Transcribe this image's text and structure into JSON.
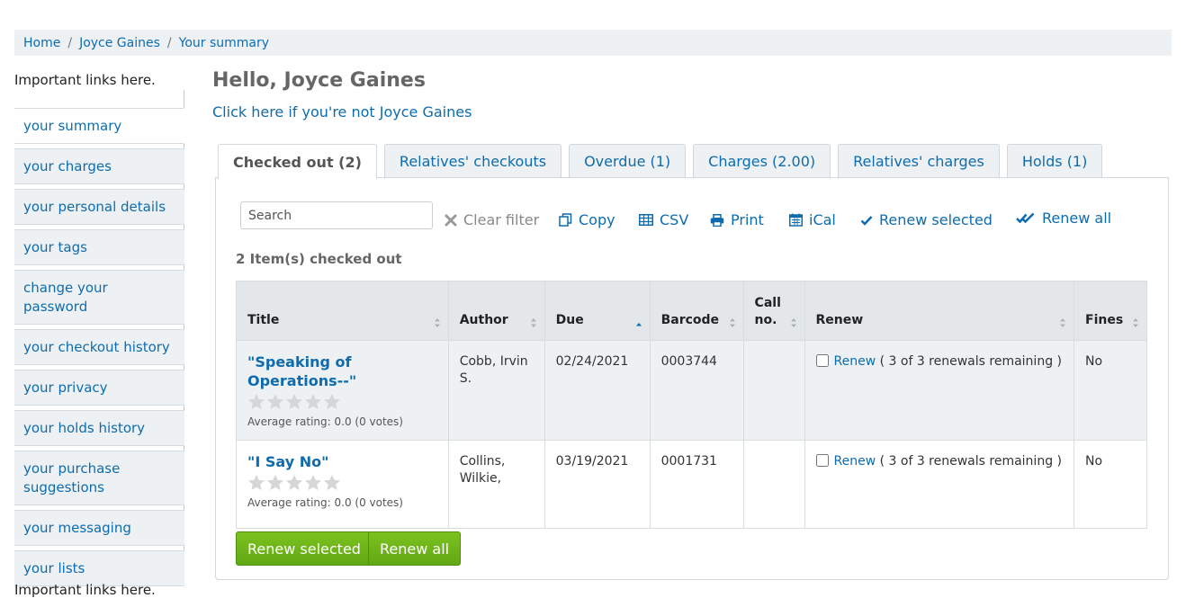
{
  "breadcrumb": {
    "home": "Home",
    "user": "Joyce Gaines",
    "current": "Your summary",
    "separator": "/"
  },
  "sidebar": {
    "important_top": "Important links here.",
    "important_bottom": "Important links here.",
    "items": [
      {
        "label": "your summary",
        "active": true
      },
      {
        "label": "your charges"
      },
      {
        "label": "your personal details"
      },
      {
        "label": "your tags"
      },
      {
        "label": "change your password"
      },
      {
        "label": "your checkout history"
      },
      {
        "label": "your privacy"
      },
      {
        "label": "your holds history"
      },
      {
        "label": "your purchase suggestions"
      },
      {
        "label": "your messaging"
      },
      {
        "label": "your lists"
      }
    ]
  },
  "main": {
    "greeting": "Hello, Joyce Gaines",
    "not_you_link": "Click here if you're not Joyce Gaines",
    "tabs": [
      {
        "label": "Checked out (2)",
        "active": true
      },
      {
        "label": "Relatives' checkouts"
      },
      {
        "label": "Overdue (1)"
      },
      {
        "label": "Charges (2.00)"
      },
      {
        "label": "Relatives' charges"
      },
      {
        "label": "Holds (1)"
      }
    ],
    "toolbar": {
      "search_placeholder": "Search",
      "clear_filter": "Clear filter",
      "copy": "Copy",
      "csv": "CSV",
      "print": "Print",
      "ical": "iCal",
      "renew_selected": "Renew selected",
      "renew_all": "Renew all"
    },
    "items_count": "2 Item(s) checked out",
    "table": {
      "headers": {
        "title": "Title",
        "author": "Author",
        "due": "Due",
        "barcode": "Barcode",
        "call_no": "Call no.",
        "renew": "Renew",
        "fines": "Fines"
      },
      "rows": [
        {
          "title": "\"Speaking of Operations--\"",
          "rating": "Average rating: 0.0 (0 votes)",
          "author": "Cobb, Irvin S.",
          "due": "02/24/2021",
          "overdue": true,
          "barcode": "0003744",
          "call_no": "",
          "renew_link": "Renew",
          "renew_note": "( 3 of 3 renewals remaining )",
          "fines": "No"
        },
        {
          "title": "\"I Say No\"",
          "rating": "Average rating: 0.0 (0 votes)",
          "author": "Collins, Wilkie,",
          "due": "03/19/2021",
          "overdue": false,
          "barcode": "0001731",
          "call_no": "",
          "renew_link": "Renew",
          "renew_note": "( 3 of 3 renewals remaining )",
          "fines": "No"
        }
      ]
    },
    "buttons": {
      "renew_selected": "Renew selected",
      "renew_all": "Renew all"
    }
  },
  "colors": {
    "link": "#0e6cae",
    "overdue": "#c62828",
    "button_green": "#6cb516",
    "panel_bg": "#eef1f3"
  }
}
